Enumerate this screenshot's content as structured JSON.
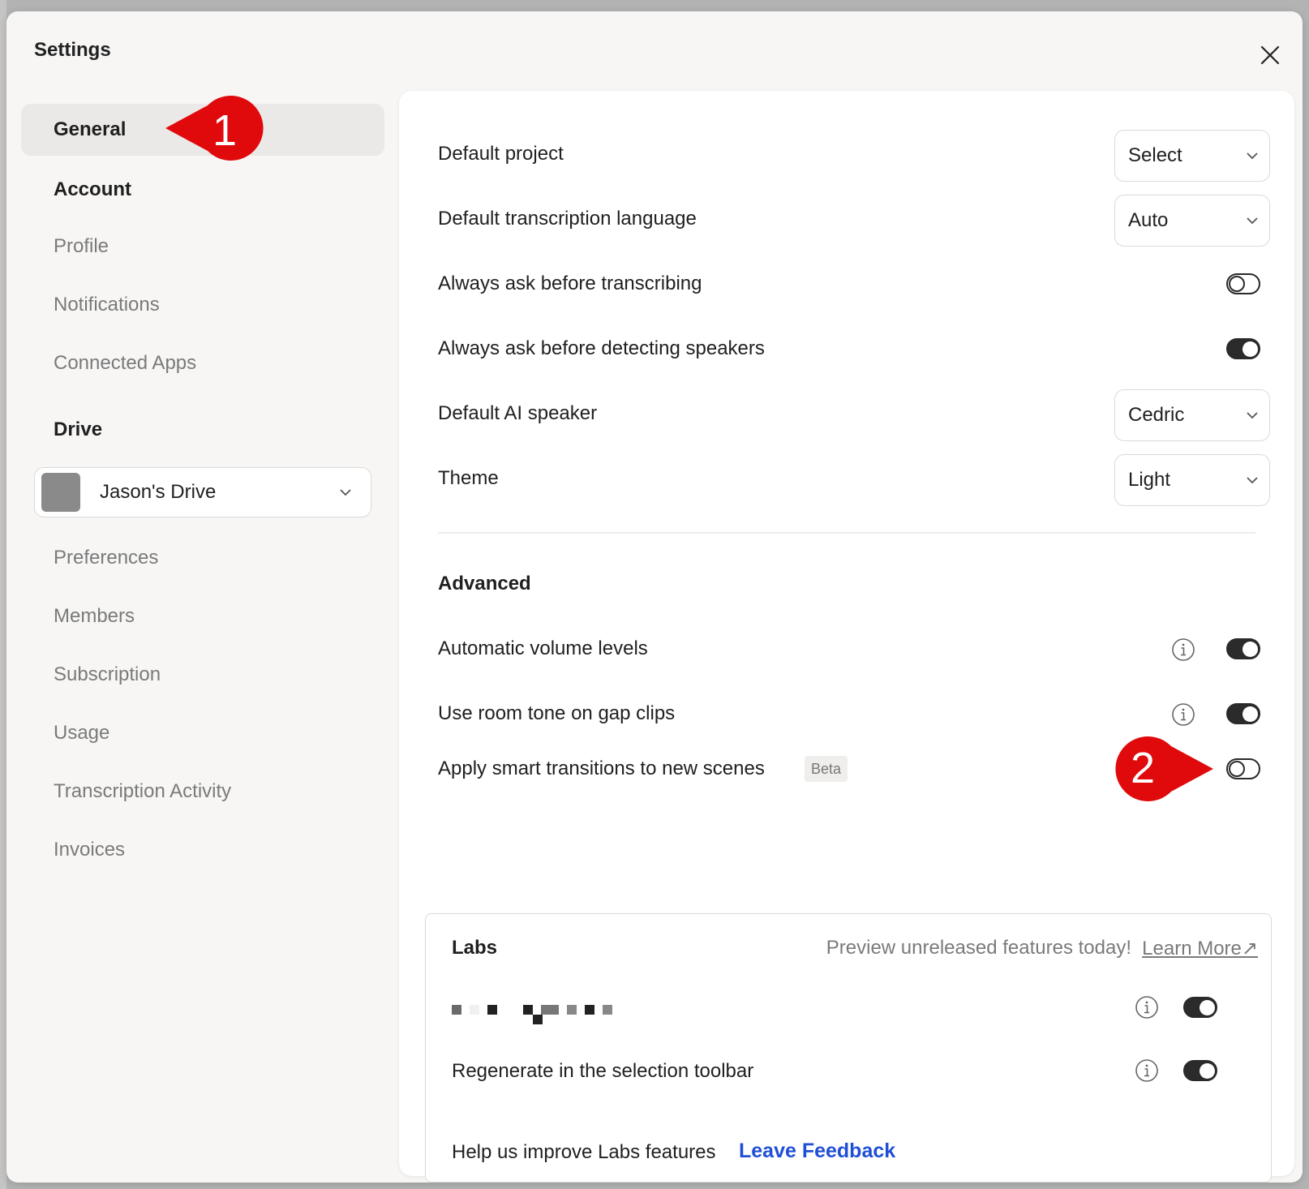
{
  "dialog": {
    "title": "Settings",
    "close_icon": "close-icon"
  },
  "sidebar": {
    "general": "General",
    "account_heading": "Account",
    "account_items": [
      "Profile",
      "Notifications",
      "Connected Apps"
    ],
    "drive_heading": "Drive",
    "drive_select": "Jason's Drive",
    "drive_items": [
      "Preferences",
      "Members",
      "Subscription",
      "Usage",
      "Transcription Activity",
      "Invoices"
    ]
  },
  "general": {
    "default_project": {
      "label": "Default project",
      "value": "Select"
    },
    "transcription_language": {
      "label": "Default transcription language",
      "value": "Auto"
    },
    "ask_transcribing": {
      "label": "Always ask before transcribing",
      "on": false
    },
    "ask_speakers": {
      "label": "Always ask before detecting speakers",
      "on": true
    },
    "ai_speaker": {
      "label": "Default AI speaker",
      "value": "Cedric"
    },
    "theme": {
      "label": "Theme",
      "value": "Light"
    }
  },
  "advanced": {
    "title": "Advanced",
    "volume_levels": {
      "label": "Automatic volume levels",
      "on": true
    },
    "room_tone": {
      "label": "Use room tone on gap clips",
      "on": true
    },
    "smart_transitions": {
      "label": "Apply smart transitions to new scenes",
      "badge": "Beta",
      "on": false
    }
  },
  "labs": {
    "title": "Labs",
    "tagline": "Preview unreleased features today!",
    "learn_more": "Learn More↗",
    "regenerate": {
      "label": "Regenerate in the selection toolbar",
      "on": true
    },
    "redacted_on": true,
    "feedback_label": "Help us improve Labs features",
    "feedback_link": "Leave Feedback"
  },
  "annotations": [
    "1",
    "2"
  ],
  "colors": {
    "marker": "#e0090c",
    "link": "#1f4fd6",
    "toggle_on": "#2b2b2b"
  }
}
